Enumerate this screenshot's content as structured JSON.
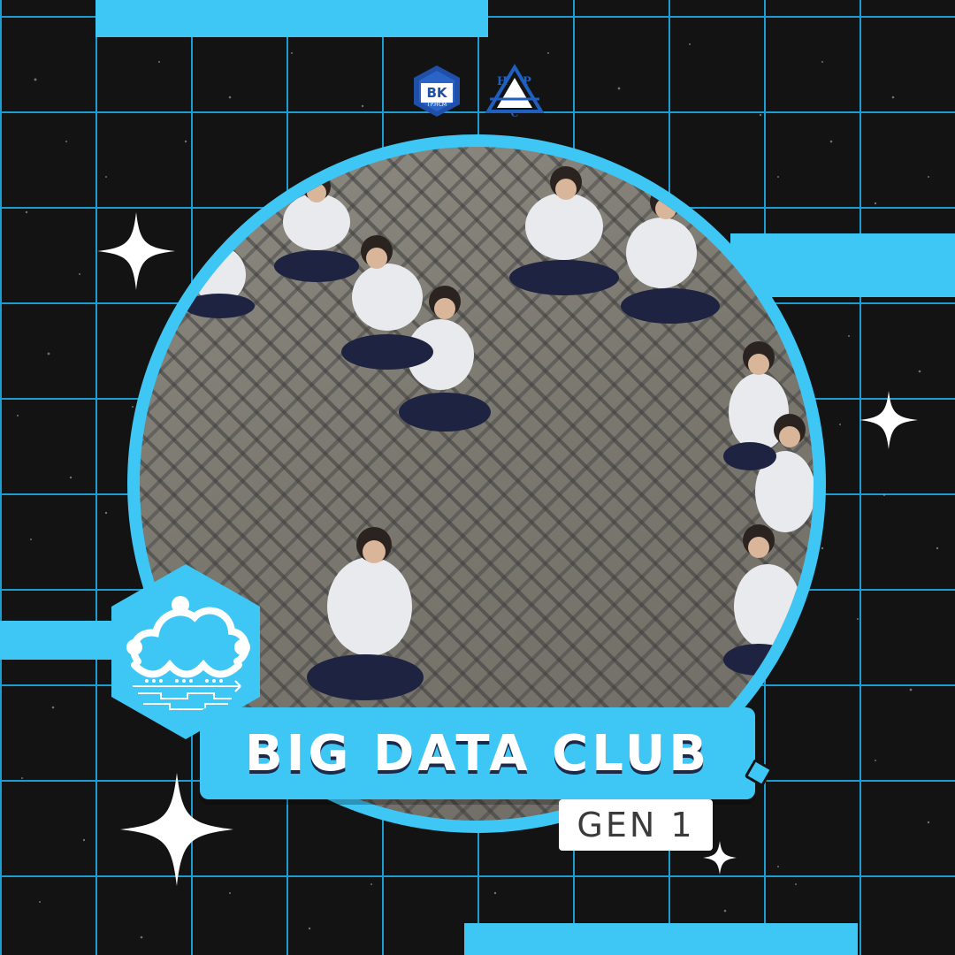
{
  "branding": {
    "title": "BIG DATA CLUB",
    "subtitle": "GEN 1",
    "logo_left_text": "BK",
    "logo_left_subtext": "TP.HCM",
    "logo_right_letters": [
      "H",
      "P",
      "C"
    ]
  },
  "icons": {
    "club_logo": "cloud-network-icon",
    "sparkles": "sparkle-icon"
  },
  "colors": {
    "accent": "#3ec6f5",
    "background": "#131313",
    "grid": "#1e9bd1",
    "title_text": "#ffffff",
    "subtitle_text": "#3b3b3b"
  }
}
